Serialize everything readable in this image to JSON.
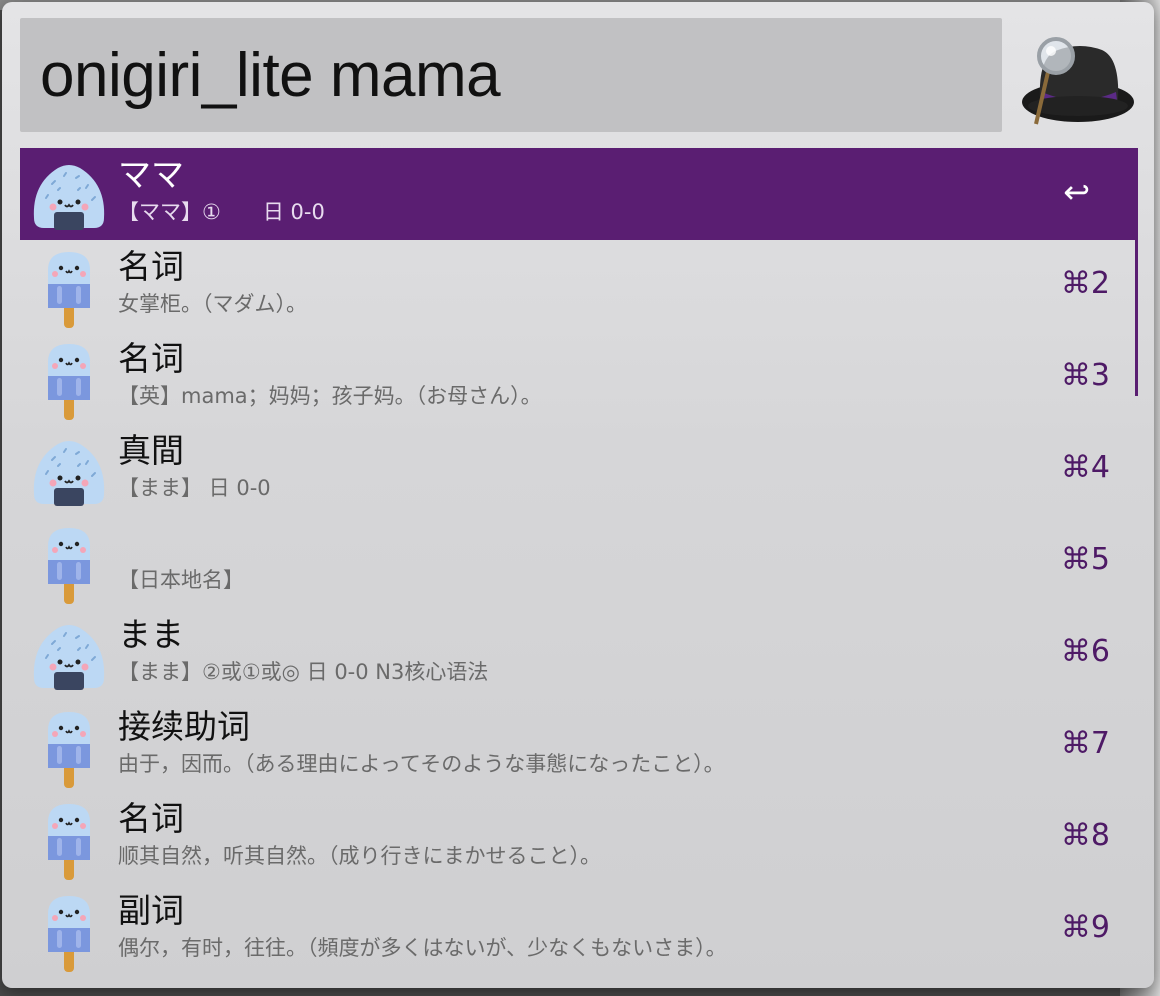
{
  "search": {
    "query": "onigiri_lite mama"
  },
  "results": [
    {
      "title": "ママ",
      "subtitle": "【ママ】①　　日  0-0",
      "shortcut": "↩",
      "icon": "onigiri-icon",
      "selected": true
    },
    {
      "title": "名词",
      "subtitle": "女掌柜。（マダム）。",
      "shortcut": "⌘2",
      "icon": "popsicle-icon"
    },
    {
      "title": "名词",
      "subtitle": "【英】mama；妈妈；孩子妈。（お母さん）。",
      "shortcut": "⌘3",
      "icon": "popsicle-icon"
    },
    {
      "title": "真間",
      "subtitle": "【まま】  日  0-0",
      "shortcut": "⌘4",
      "icon": "onigiri-icon"
    },
    {
      "title": "",
      "subtitle": "【日本地名】",
      "shortcut": "⌘5",
      "icon": "popsicle-icon"
    },
    {
      "title": "まま",
      "subtitle": "【まま】②或①或◎ 日  0-0  N3核心语法",
      "shortcut": "⌘6",
      "icon": "onigiri-icon"
    },
    {
      "title": "接续助词",
      "subtitle": "由于，因而。（ある理由によってそのような事態になったこと）。",
      "shortcut": "⌘7",
      "icon": "popsicle-icon"
    },
    {
      "title": "名词",
      "subtitle": "顺其自然，听其自然。（成り行きにまかせること）。",
      "shortcut": "⌘8",
      "icon": "popsicle-icon"
    },
    {
      "title": "副词",
      "subtitle": "偶尔，有时，往往。（頻度が多くはないが、少なくもないさま）。",
      "shortcut": "⌘9",
      "icon": "popsicle-icon"
    }
  ],
  "colors": {
    "accent": "#5a1e72",
    "shortcut": "#4e1a66",
    "background": "#d6d6d8"
  }
}
